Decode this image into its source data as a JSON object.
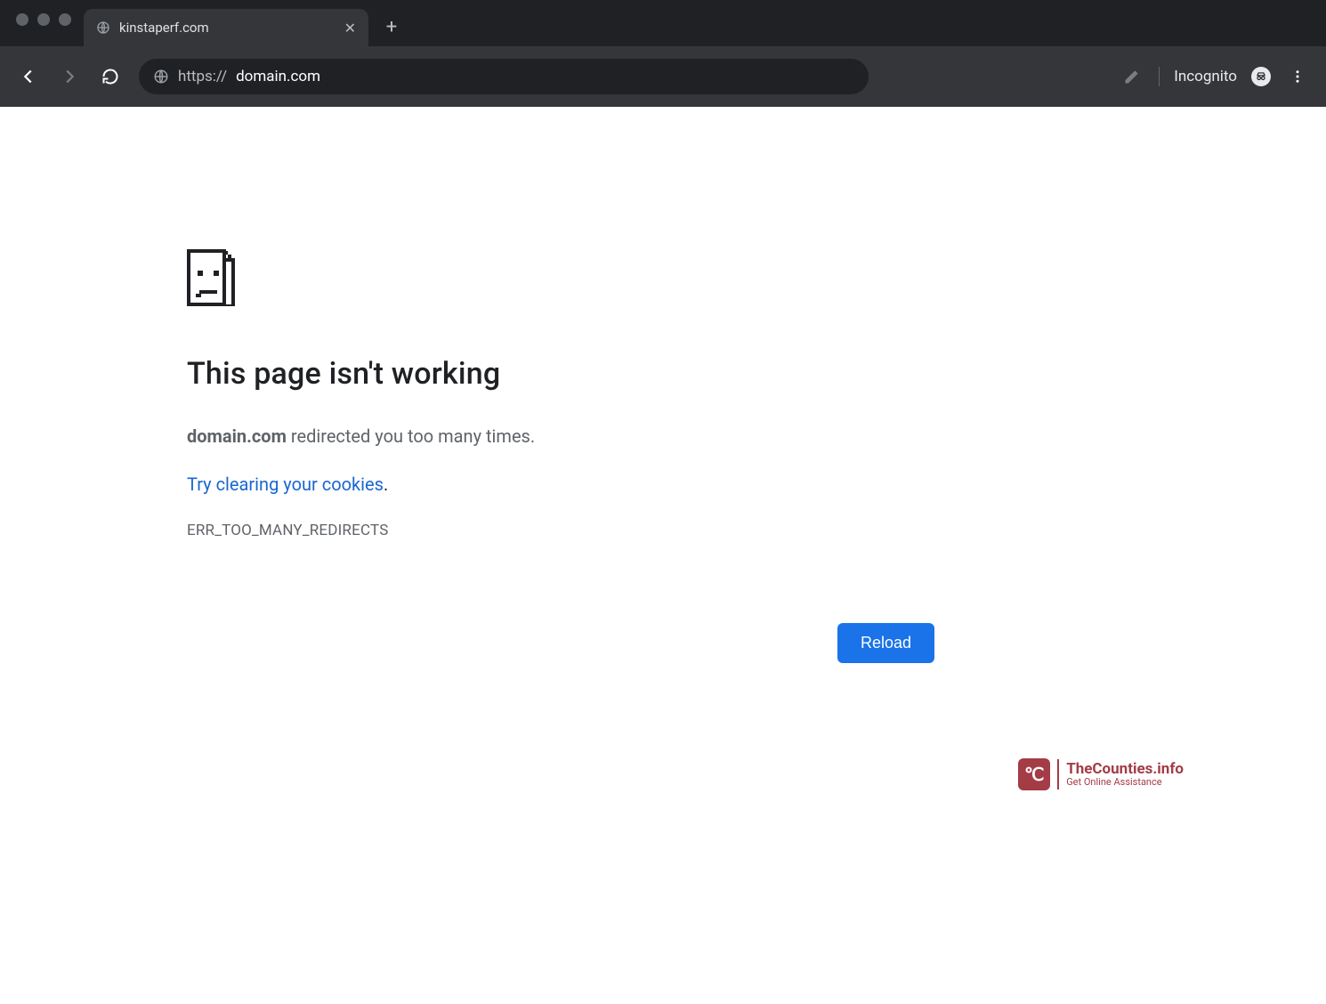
{
  "browser": {
    "tab": {
      "title": "kinstaperf.com"
    },
    "url_protocol": "https://",
    "url_host": "domain.com",
    "incognito_label": "Incognito"
  },
  "error": {
    "heading": "This page isn't working",
    "host_bold": "domain.com",
    "desc_rest": " redirected you too many times.",
    "link_text": "Try clearing your cookies",
    "link_period": ".",
    "code": "ERR_TOO_MANY_REDIRECTS",
    "reload_label": "Reload"
  },
  "watermark": {
    "glyph": "℃",
    "title": "TheCounties.info",
    "subtitle": "Get Online Assistance"
  }
}
